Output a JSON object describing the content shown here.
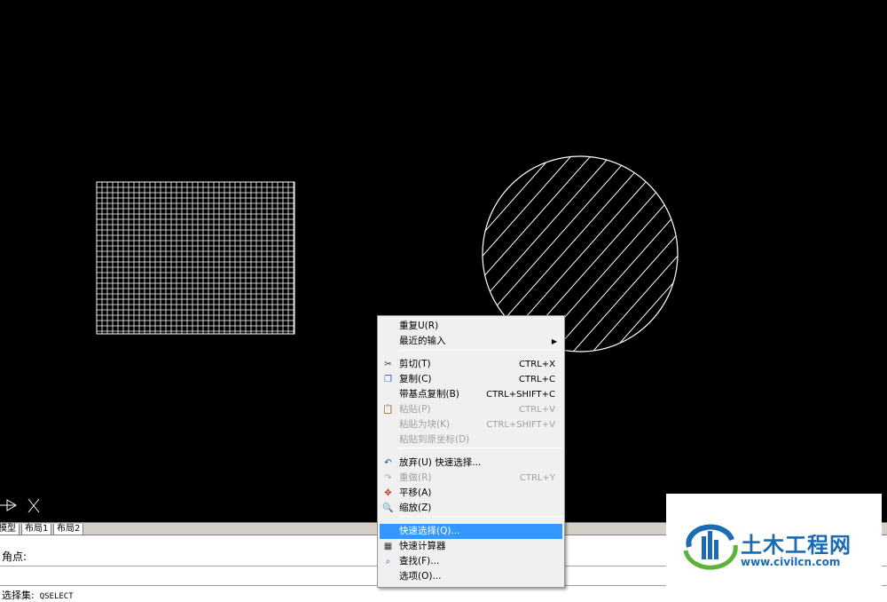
{
  "layout_tabs": [
    "模型",
    "布局1",
    "布局2"
  ],
  "command": {
    "history": "角点:",
    "prompt_label": "选择集:",
    "prompt_command": "QSELECT"
  },
  "context_menu": {
    "items": [
      {
        "label": "重复U(R)",
        "shortcut": "",
        "icon": "",
        "state": "normal",
        "submenu": false
      },
      {
        "label": "最近的输入",
        "shortcut": "",
        "icon": "",
        "state": "normal",
        "submenu": true
      },
      {
        "label": "剪切(T)",
        "shortcut": "CTRL+X",
        "icon": "scissors-icon",
        "state": "normal",
        "submenu": false
      },
      {
        "label": "复制(C)",
        "shortcut": "CTRL+C",
        "icon": "copy-icon",
        "state": "normal",
        "submenu": false
      },
      {
        "label": "带基点复制(B)",
        "shortcut": "CTRL+SHIFT+C",
        "icon": "",
        "state": "normal",
        "submenu": false
      },
      {
        "label": "粘贴(P)",
        "shortcut": "CTRL+V",
        "icon": "paste-icon",
        "state": "disabled",
        "submenu": false
      },
      {
        "label": "粘贴为块(K)",
        "shortcut": "CTRL+SHIFT+V",
        "icon": "",
        "state": "disabled",
        "submenu": false
      },
      {
        "label": "粘贴到原坐标(D)",
        "shortcut": "",
        "icon": "",
        "state": "disabled",
        "submenu": false
      },
      {
        "label": "放弃(U) 快速选择...",
        "shortcut": "",
        "icon": "undo-icon",
        "state": "normal",
        "submenu": false
      },
      {
        "label": "重做(R)",
        "shortcut": "CTRL+Y",
        "icon": "redo-icon",
        "state": "disabled",
        "submenu": false
      },
      {
        "label": "平移(A)",
        "shortcut": "",
        "icon": "pan-icon",
        "state": "normal",
        "submenu": false
      },
      {
        "label": "缩放(Z)",
        "shortcut": "",
        "icon": "zoom-icon",
        "state": "normal",
        "submenu": false
      },
      {
        "label": "快速选择(Q)...",
        "shortcut": "",
        "icon": "",
        "state": "highlight",
        "submenu": false
      },
      {
        "label": "快速计算器",
        "shortcut": "",
        "icon": "calculator-icon",
        "state": "normal",
        "submenu": false
      },
      {
        "label": "查找(F)...",
        "shortcut": "",
        "icon": "find-icon",
        "state": "normal",
        "submenu": false
      },
      {
        "label": "选项(O)...",
        "shortcut": "",
        "icon": "",
        "state": "normal",
        "submenu": false
      }
    ]
  },
  "watermark": {
    "title": "土木工程网",
    "url": "www.civilcn.com"
  },
  "colors": {
    "canvas_bg": "#000000",
    "drawing_lines": "#ffffff",
    "menu_highlight": "#3399ff",
    "watermark_blue": "#1a6bb3",
    "watermark_green": "#5db33a"
  }
}
